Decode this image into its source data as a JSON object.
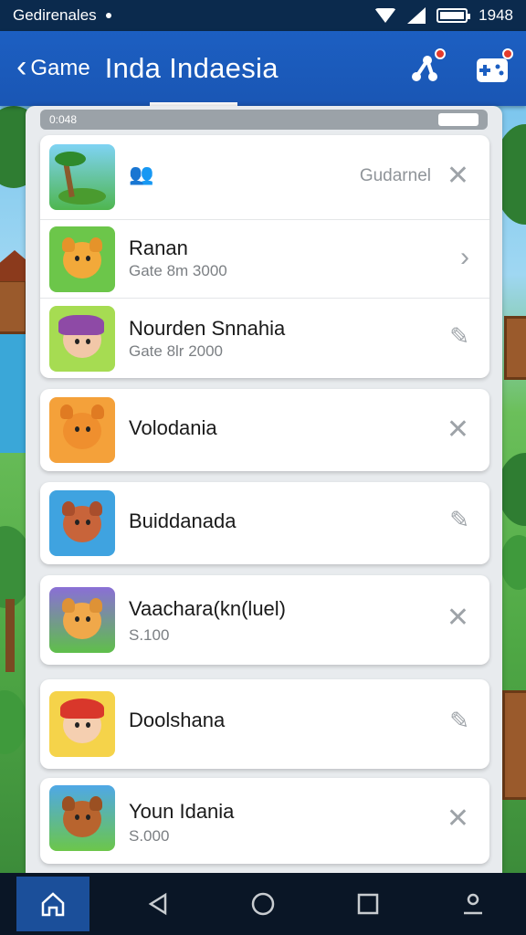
{
  "status_bar": {
    "carrier": "Gedirenales",
    "time": "1948"
  },
  "app_bar": {
    "back_label": "Game",
    "title": "Inda Indaesia"
  },
  "mini_status": {
    "left": "0:048"
  },
  "list": [
    {
      "id": "row-1",
      "title": "",
      "emoji": "👥",
      "link": "Gudarnel",
      "subtitle": "",
      "action": "close-icon"
    },
    {
      "id": "row-2",
      "title": "Ranan",
      "subtitle": "Gate 8m 3000",
      "action": "chevron-right-icon"
    },
    {
      "id": "row-3",
      "title": "Nourden Snnahia",
      "subtitle": "Gate 8lr 2000",
      "action": "pencil-icon"
    },
    {
      "id": "row-4",
      "title": "Volodania",
      "subtitle": "",
      "action": "close-icon"
    },
    {
      "id": "row-5",
      "title": "Buiddanada",
      "subtitle": "",
      "action": "pencil-icon"
    },
    {
      "id": "row-6",
      "title": "Vaachara(kn(luel)",
      "subtitle": "S.100",
      "action": "close-icon"
    },
    {
      "id": "row-7",
      "title": "Doolshana",
      "subtitle": "",
      "action": "pencil-icon"
    },
    {
      "id": "row-8",
      "title": "Youn Idania",
      "subtitle": "S.000",
      "action": "close-icon"
    }
  ],
  "colors": {
    "app_bar": "#1c5fc2",
    "status_bar": "#0b2a4d",
    "nav_bar": "#0a1626",
    "nav_active": "#1b4f9a"
  }
}
